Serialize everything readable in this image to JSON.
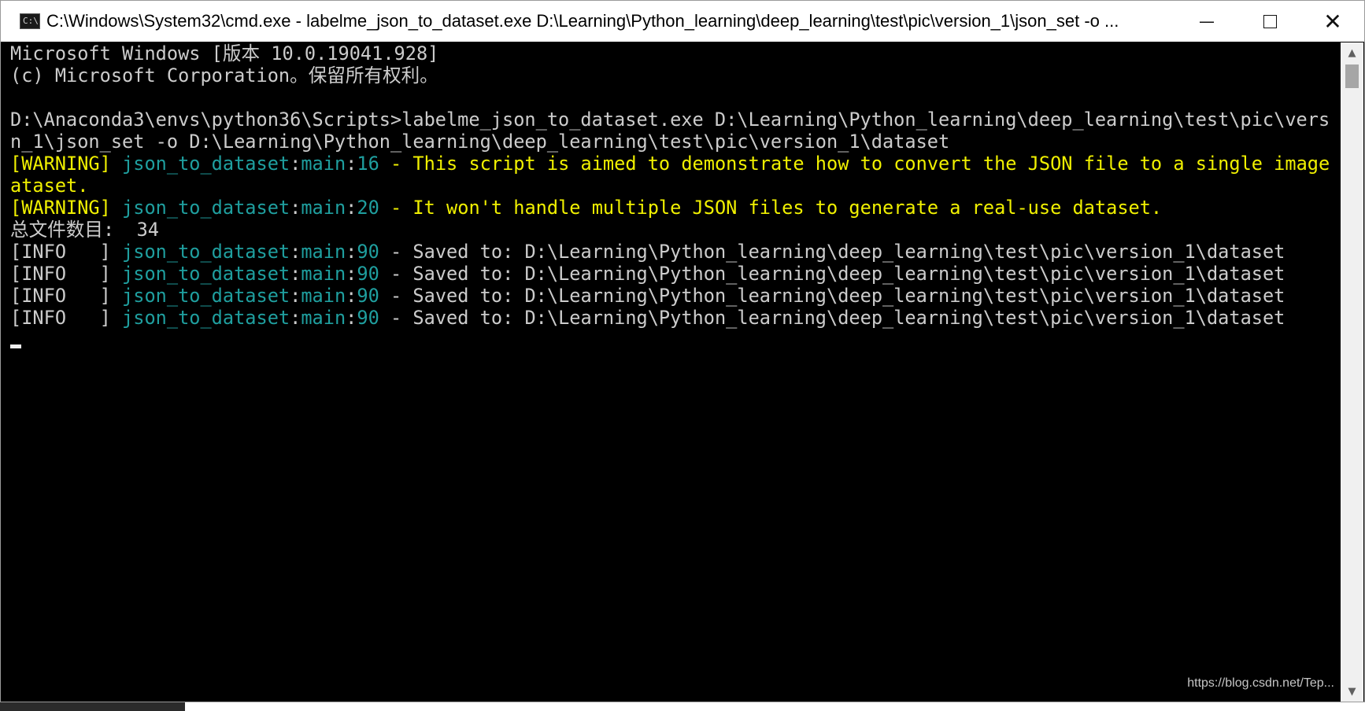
{
  "window": {
    "title": "C:\\Windows\\System32\\cmd.exe - labelme_json_to_dataset.exe  D:\\Learning\\Python_learning\\deep_learning\\test\\pic\\version_1\\json_set -o ...",
    "icon_label": "C:\\",
    "controls": {
      "minimize": "—",
      "close": "✕"
    }
  },
  "console": {
    "lines": [
      [
        {
          "t": "Microsoft Windows [版本 10.0.19041.928]",
          "c": "white"
        }
      ],
      [
        {
          "t": "(c) Microsoft Corporation。保留所有权利。",
          "c": "white"
        }
      ],
      [
        {
          "t": "",
          "c": "white"
        }
      ],
      [
        {
          "t": "D:\\Anaconda3\\envs\\python36\\Scripts>labelme_json_to_dataset.exe D:\\Learning\\Python_learning\\deep_learning\\test\\pic\\versio",
          "c": "white"
        }
      ],
      [
        {
          "t": "n_1\\json_set -o D:\\Learning\\Python_learning\\deep_learning\\test\\pic\\version_1\\dataset",
          "c": "white"
        }
      ],
      [
        {
          "t": "[WARNING] ",
          "c": "yellow"
        },
        {
          "t": "json_to_dataset",
          "c": "teal"
        },
        {
          "t": ":",
          "c": "white"
        },
        {
          "t": "main",
          "c": "teal"
        },
        {
          "t": ":",
          "c": "white"
        },
        {
          "t": "16",
          "c": "teal"
        },
        {
          "t": " - This script is aimed to demonstrate how to convert the JSON file to a single image d",
          "c": "yellow"
        }
      ],
      [
        {
          "t": "ataset.",
          "c": "yellow"
        }
      ],
      [
        {
          "t": "[WARNING] ",
          "c": "yellow"
        },
        {
          "t": "json_to_dataset",
          "c": "teal"
        },
        {
          "t": ":",
          "c": "white"
        },
        {
          "t": "main",
          "c": "teal"
        },
        {
          "t": ":",
          "c": "white"
        },
        {
          "t": "20",
          "c": "teal"
        },
        {
          "t": " - It won't handle multiple JSON files to generate a real-use dataset.",
          "c": "yellow"
        }
      ],
      [
        {
          "t": "总文件数目:  34",
          "c": "white"
        }
      ],
      [
        {
          "t": "[INFO   ] ",
          "c": "white"
        },
        {
          "t": "json_to_dataset",
          "c": "teal"
        },
        {
          "t": ":",
          "c": "white"
        },
        {
          "t": "main",
          "c": "teal"
        },
        {
          "t": ":",
          "c": "white"
        },
        {
          "t": "90",
          "c": "teal"
        },
        {
          "t": " - Saved to: D:\\Learning\\Python_learning\\deep_learning\\test\\pic\\version_1\\dataset",
          "c": "white"
        }
      ],
      [
        {
          "t": "[INFO   ] ",
          "c": "white"
        },
        {
          "t": "json_to_dataset",
          "c": "teal"
        },
        {
          "t": ":",
          "c": "white"
        },
        {
          "t": "main",
          "c": "teal"
        },
        {
          "t": ":",
          "c": "white"
        },
        {
          "t": "90",
          "c": "teal"
        },
        {
          "t": " - Saved to: D:\\Learning\\Python_learning\\deep_learning\\test\\pic\\version_1\\dataset",
          "c": "white"
        }
      ],
      [
        {
          "t": "[INFO   ] ",
          "c": "white"
        },
        {
          "t": "json_to_dataset",
          "c": "teal"
        },
        {
          "t": ":",
          "c": "white"
        },
        {
          "t": "main",
          "c": "teal"
        },
        {
          "t": ":",
          "c": "white"
        },
        {
          "t": "90",
          "c": "teal"
        },
        {
          "t": " - Saved to: D:\\Learning\\Python_learning\\deep_learning\\test\\pic\\version_1\\dataset",
          "c": "white"
        }
      ],
      [
        {
          "t": "[INFO   ] ",
          "c": "white"
        },
        {
          "t": "json_to_dataset",
          "c": "teal"
        },
        {
          "t": ":",
          "c": "white"
        },
        {
          "t": "main",
          "c": "teal"
        },
        {
          "t": ":",
          "c": "white"
        },
        {
          "t": "90",
          "c": "teal"
        },
        {
          "t": " - Saved to: D:\\Learning\\Python_learning\\deep_learning\\test\\pic\\version_1\\dataset",
          "c": "white"
        }
      ]
    ]
  },
  "colors": {
    "white": "#cccccc",
    "yellow": "#f0f000",
    "teal": "#1f9f9f",
    "background": "#000000"
  },
  "watermark": "https://blog.csdn.net/Tep..."
}
